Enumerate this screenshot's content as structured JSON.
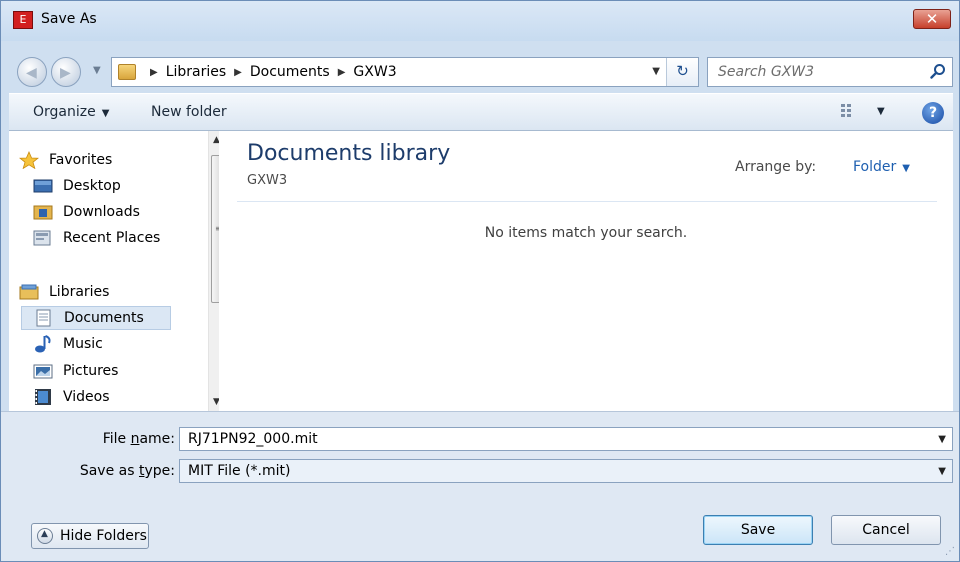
{
  "window": {
    "title": "Save As",
    "close_label": "✕",
    "app_icon_text": "E"
  },
  "address_bar": {
    "crumbs": [
      "Libraries",
      "Documents",
      "GXW3"
    ],
    "search_placeholder": "Search GXW3"
  },
  "command_bar": {
    "organize": "Organize",
    "new_folder": "New folder"
  },
  "nav_pane": {
    "favorites_header": "Favorites",
    "favorites": [
      "Desktop",
      "Downloads",
      "Recent Places"
    ],
    "libraries_header": "Libraries",
    "libraries": [
      "Documents",
      "Music",
      "Pictures",
      "Videos"
    ],
    "selected": "Documents"
  },
  "content": {
    "title": "Documents library",
    "subtitle": "GXW3",
    "arrange_label": "Arrange by:",
    "arrange_value": "Folder",
    "empty_message": "No items match your search."
  },
  "form": {
    "file_name_label_pre": "File ",
    "file_name_label_u": "n",
    "file_name_label_post": "ame:",
    "file_name_value": "RJ71PN92_000.mit",
    "save_type_label_pre": "Save as ",
    "save_type_label_u": "t",
    "save_type_label_post": "ype:",
    "save_type_value": "MIT File (*.mit)"
  },
  "buttons": {
    "hide_folders": "Hide Folders",
    "save": "Save",
    "cancel": "Cancel"
  },
  "colors": {
    "accent": "#1e5fb0",
    "title_text": "#1d3c6b",
    "close": "#c6402c"
  }
}
